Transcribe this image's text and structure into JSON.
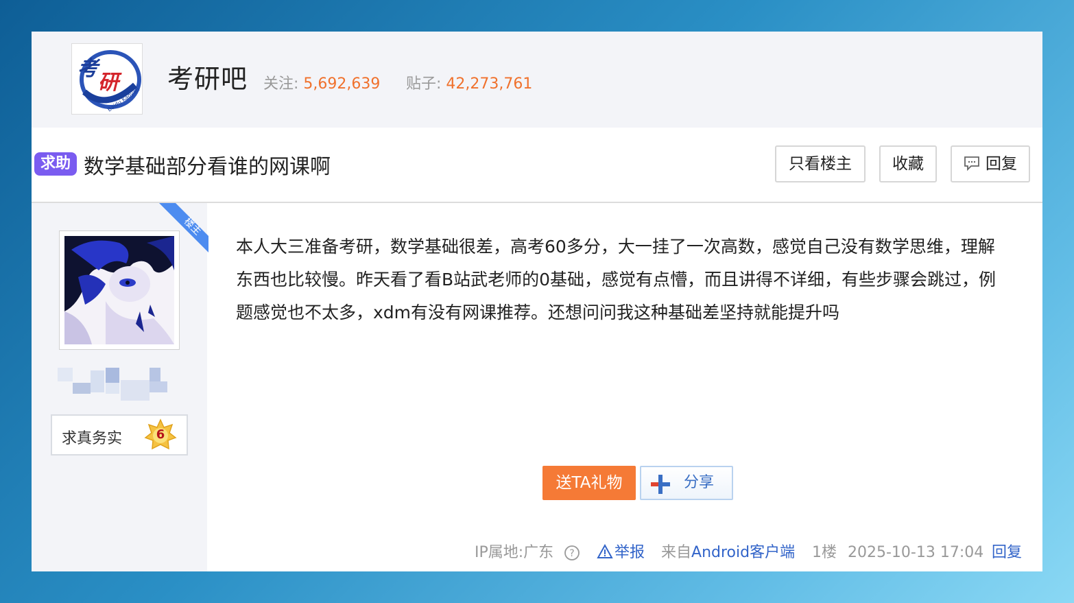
{
  "forum": {
    "name": "考研吧",
    "logo_text": "考研",
    "logo_subtext": "Baidu Kaoyan",
    "follow_label": "关注:",
    "follow_count": "5,692,639",
    "posts_label": "贴子:",
    "posts_count": "42,273,761"
  },
  "thread": {
    "tag": "求助",
    "title": "数学基础部分看谁的网课啊",
    "buttons": {
      "only_op": "只看楼主",
      "collect": "收藏",
      "reply": "回复"
    }
  },
  "author": {
    "op_badge": "楼主",
    "level_title": "求真务实",
    "level": "6"
  },
  "post": {
    "body": "本人大三准备考研，数学基础很差，高考60多分，大一挂了一次高数，感觉自己没有数学思维，理解东西也比较慢。昨天看了看B站武老师的0基础，感觉有点懵，而且讲得不详细，有些步骤会跳过，例题感觉也不太多，xdm有没有网课推荐。还想问问我这种基础差坚持就能提升吗",
    "gift_button": "送TA礼物",
    "share_button": "分享"
  },
  "footer": {
    "ip": "IP属地:广东",
    "report": "举报",
    "from_prefix": "来自",
    "client": "Android客户端",
    "floor": "1楼",
    "time": "2025-10-13 17:04",
    "reply": "回复"
  },
  "colors": {
    "accent_orange": "#f0712c",
    "tag_purple": "#7a5cf0",
    "link_blue": "#3264c9"
  }
}
